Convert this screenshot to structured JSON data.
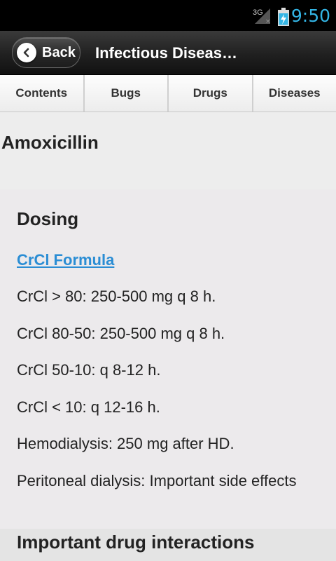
{
  "status_bar": {
    "network_label": "3G",
    "time": "9:50",
    "icons": [
      "signal-icon",
      "battery-charging-icon"
    ]
  },
  "title_bar": {
    "back_label": "Back",
    "title": "Infectious Diseas…"
  },
  "tabs": [
    {
      "label": "Contents"
    },
    {
      "label": "Bugs"
    },
    {
      "label": "Drugs"
    },
    {
      "label": "Diseases"
    }
  ],
  "drug": {
    "name": "Amoxicillin"
  },
  "dosing": {
    "heading": "Dosing",
    "formula_link": "CrCl Formula",
    "lines": [
      "CrCl > 80: 250-500 mg q 8 h.",
      "CrCl 80-50: 250-500 mg q 8 h.",
      "CrCl 50-10: q 8-12 h.",
      "CrCl < 10: q 12-16 h.",
      "Hemodialysis: 250 mg after HD.",
      "Peritoneal dialysis: Important side effects"
    ]
  },
  "interactions": {
    "heading": "Important drug interactions"
  },
  "colors": {
    "accent": "#33b5e5",
    "link": "#2a8dd4",
    "title_bar": "#202020"
  }
}
